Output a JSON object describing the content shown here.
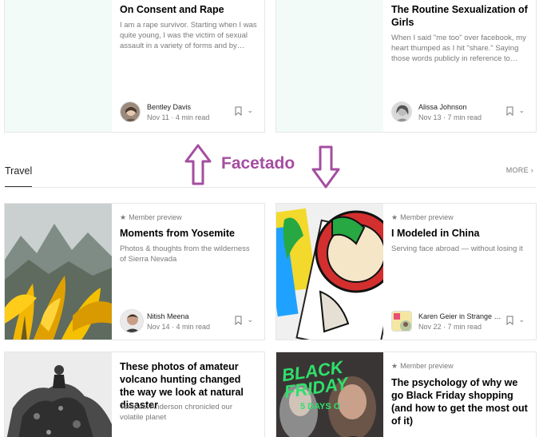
{
  "annotation": {
    "text": "Facetado",
    "color": "#a44ea0"
  },
  "colors": {
    "thumb_placeholder": "#f2fbf8",
    "border": "#e6e6e6",
    "muted_text": "#7a7a7a"
  },
  "top_cards": [
    {
      "title": "On Consent and Rape",
      "description": "I am a rape survivor. Starting when I was quite young, I was the victim of sexual assault in a variety of forms and by…",
      "author": "Bentley Davis",
      "meta": "Nov 11 · 4 min read"
    },
    {
      "title": "The Routine Sexualization of Girls",
      "description": "When I said \"me too\" over facebook, my heart thumped as I hit \"share.\" Saying those words publicly in reference to…",
      "author": "Alissa Johnson",
      "meta": "Nov 13 · 7 min read"
    }
  ],
  "section": {
    "title": "Travel",
    "more_label": "MORE"
  },
  "travel_cards": [
    {
      "member_label": "Member preview",
      "title": "Moments from Yosemite",
      "description": "Photos & thoughts from the wilderness of Sierra Nevada",
      "author": "Nitish Meena",
      "meta": "Nov 14 · 4 min read"
    },
    {
      "member_label": "Member preview",
      "title": "I Modeled in China",
      "description": "Serving face abroad — without losing it",
      "author": "Karen Geier in Strange …",
      "meta": "Nov 22 · 7 min read"
    }
  ],
  "bottom_cards": [
    {
      "title": "These photos of amateur volcano hunting changed the way we look at natural disaster",
      "description": "Tempest Anderson chronicled our volatile planet"
    },
    {
      "member_label": "Member preview",
      "title": "The psychology of why we go Black Friday shopping (and how to get the most out of it)",
      "image_text": "BLACK FRIDAY",
      "image_subtext": "5 DAYS O"
    }
  ],
  "icons": {
    "bookmark": "bookmark-icon",
    "chevron": "chevron-down-icon",
    "star": "star-icon",
    "arrow_up": "arrow-up-icon",
    "arrow_down": "arrow-down-icon"
  }
}
